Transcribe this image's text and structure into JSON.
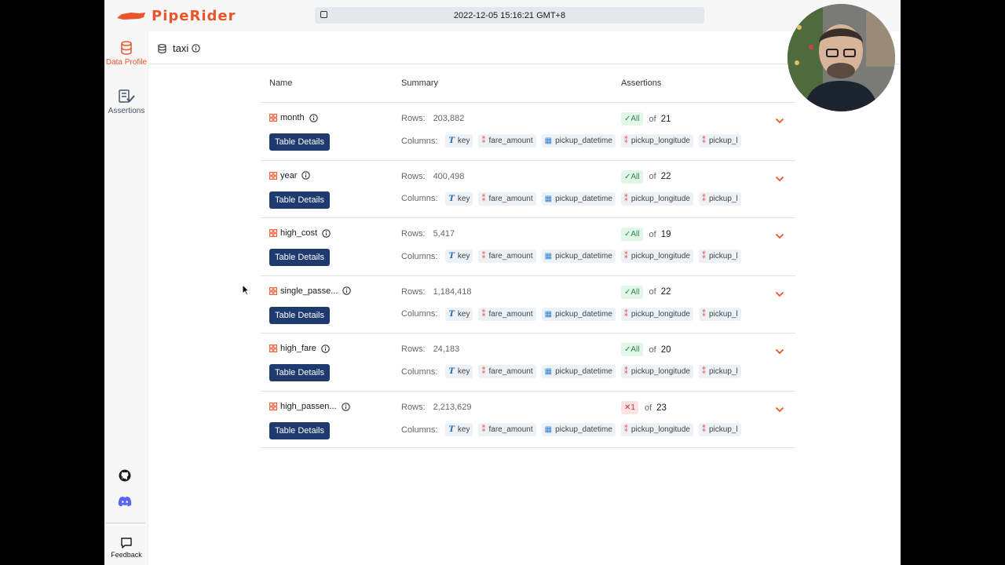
{
  "app": {
    "logo": "PipeRider",
    "datetime": "2022-12-05 15:16:21 GMT+8"
  },
  "sidebar": {
    "data_profile": "Data Profile",
    "assertions": "Assertions",
    "feedback": "Feedback"
  },
  "breadcrumb": {
    "source": "taxi"
  },
  "table_header": {
    "name": "Name",
    "summary": "Summary",
    "assertions": "Assertions"
  },
  "labels": {
    "rows": "Rows:",
    "columns": "Columns:",
    "of": "of",
    "details": "Table Details"
  },
  "columns": [
    "key",
    "fare_amount",
    "pickup_datetime",
    "pickup_longitude",
    "pickup_l"
  ],
  "tables": [
    {
      "name": "month",
      "rows": "203,882",
      "badge": "✓All",
      "status": "pass",
      "total": "21"
    },
    {
      "name": "year",
      "rows": "400,498",
      "badge": "✓All",
      "status": "pass",
      "total": "22"
    },
    {
      "name": "high_cost",
      "rows": "5,417",
      "badge": "✓All",
      "status": "pass",
      "total": "19"
    },
    {
      "name": "single_passe...",
      "rows": "1,184,418",
      "badge": "✓All",
      "status": "pass",
      "total": "22"
    },
    {
      "name": "high_fare",
      "rows": "24,183",
      "badge": "✓All",
      "status": "pass",
      "total": "20"
    },
    {
      "name": "high_passen...",
      "rows": "2,213,629",
      "badge": "✕1",
      "status": "fail",
      "total": "23"
    }
  ],
  "colors": {
    "brand": "#e8552b",
    "button": "#1e3a6e",
    "pass_bg": "#e2f7e8",
    "fail_bg": "#fde2e4"
  },
  "icons": {
    "data_profile": "database-icon",
    "assertions": "checklist-icon",
    "github": "github-icon",
    "discord": "discord-icon",
    "feedback": "chat-icon"
  }
}
